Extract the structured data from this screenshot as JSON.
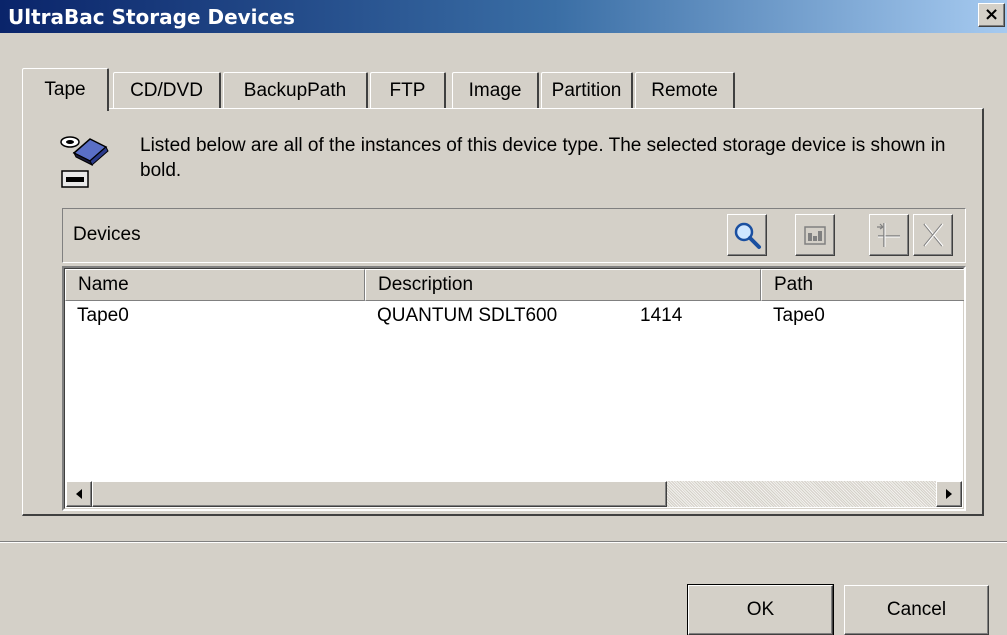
{
  "window": {
    "title": "UltraBac Storage Devices",
    "close_label": "×"
  },
  "tabs": [
    {
      "label": "Tape",
      "active": true
    },
    {
      "label": "CD/DVD",
      "active": false
    },
    {
      "label": "BackupPath",
      "active": false
    },
    {
      "label": "FTP",
      "active": false
    },
    {
      "label": "Image",
      "active": false
    },
    {
      "label": "Partition",
      "active": false
    },
    {
      "label": "Remote",
      "active": false
    }
  ],
  "info": {
    "text": "Listed below are all of the instances of this device type. The selected storage device is shown in bold.",
    "icon": "tape-drive-icon"
  },
  "devices_bar": {
    "label": "Devices",
    "tools": [
      "search-icon",
      "properties-icon",
      "add-device-icon",
      "delete-icon"
    ]
  },
  "list": {
    "columns": [
      "Name",
      "Description",
      "Path"
    ],
    "rows": [
      {
        "name": "Tape0",
        "description": "QUANTUM SDLT600",
        "revision": "1414",
        "path": "Tape0"
      }
    ]
  },
  "buttons": {
    "ok": "OK",
    "cancel": "Cancel"
  },
  "colors": {
    "titlebar_start": "#0a246a",
    "titlebar_end": "#a6caf0",
    "face": "#d4d0c8"
  }
}
